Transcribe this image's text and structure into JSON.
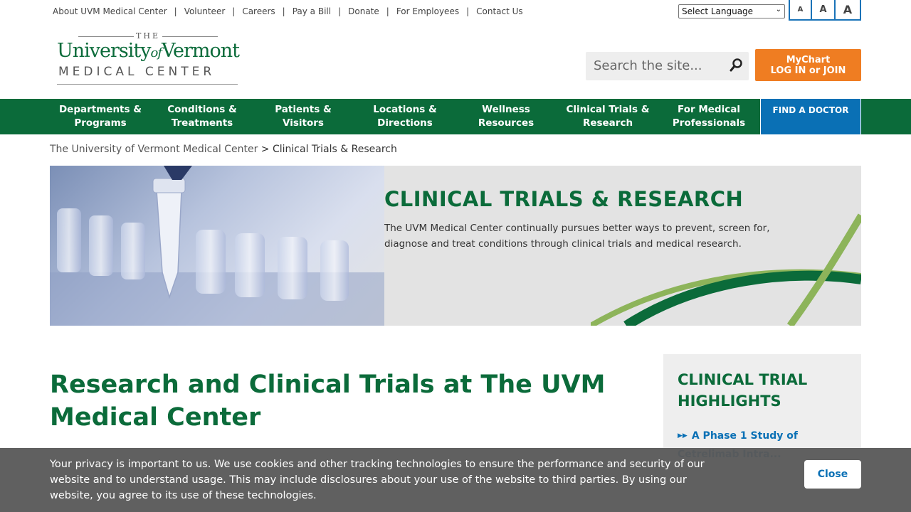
{
  "utility": {
    "links": [
      "About UVM Medical Center",
      "Volunteer",
      "Careers",
      "Pay a Bill",
      "Donate",
      "For Employees",
      "Contact Us"
    ],
    "separator": "|",
    "language_select": "Select Language",
    "font_sizes": [
      "A",
      "A",
      "A"
    ]
  },
  "logo": {
    "the": "THE",
    "university": "University",
    "of": "of",
    "vermont": "Vermont",
    "medical_center": "MEDICAL CENTER"
  },
  "search": {
    "placeholder": "Search the site..."
  },
  "mychart": {
    "line1": "MyChart",
    "line2": "LOG IN or JOIN"
  },
  "nav": {
    "items": [
      "Departments & Programs",
      "Conditions & Treatments",
      "Patients & Visitors",
      "Locations & Directions",
      "Wellness Resources",
      "Clinical Trials & Research",
      "For Medical Professionals"
    ],
    "find_doctor": "FIND A DOCTOR"
  },
  "breadcrumb": {
    "home": "The University of Vermont Medical Center",
    "separator": ">",
    "current": "Clinical Trials & Research"
  },
  "hero": {
    "title": "CLINICAL TRIALS & RESEARCH",
    "description": "The UVM Medical Center continually pursues better ways to prevent, screen for, diagnose and treat conditions through clinical trials and medical research."
  },
  "main": {
    "heading": "Research and Clinical Trials at The UVM Medical Center"
  },
  "sidebar": {
    "title": "CLINICAL TRIAL HIGHLIGHTS",
    "items": [
      "A Phase 1 Study of Cetrelimab Intra..."
    ]
  },
  "cookie": {
    "text": "Your privacy is important to us. We use cookies and other tracking technologies to ensure the performance and security of our website and to understand usage. This may include disclosures about your use of the website to third parties. By using our website, you agree to its use of these technologies.",
    "close": "Close"
  },
  "colors": {
    "brand_green": "#0b6b3a",
    "accent_orange": "#ef7d22",
    "accent_blue": "#0a70b5"
  }
}
